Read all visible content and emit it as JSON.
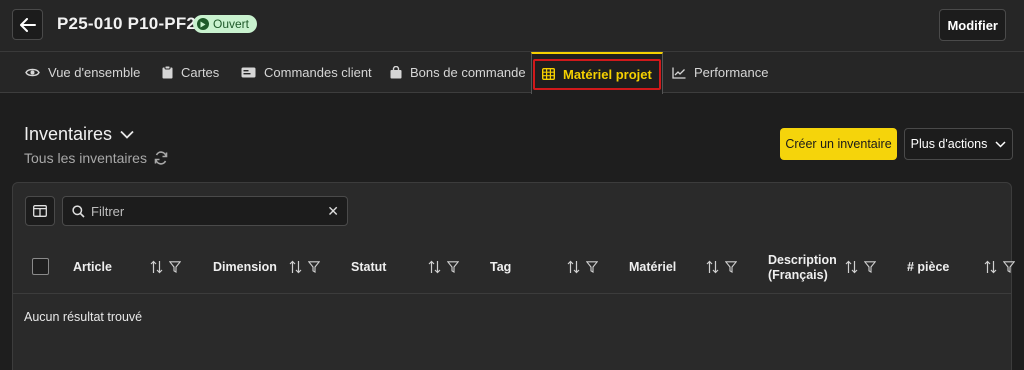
{
  "header": {
    "title": "P25-010 P10-PF2",
    "status": "Ouvert",
    "edit_label": "Modifier"
  },
  "tabs": [
    {
      "label": "Vue d'ensemble",
      "icon": "eye-icon"
    },
    {
      "label": "Cartes",
      "icon": "clipboard-icon"
    },
    {
      "label": "Commandes client",
      "icon": "id-card-icon"
    },
    {
      "label": "Bons de commande",
      "icon": "shopping-bag-icon"
    },
    {
      "label": "Matériel projet",
      "icon": "grid-table-icon",
      "active": true
    },
    {
      "label": "Performance",
      "icon": "line-chart-icon"
    }
  ],
  "section": {
    "title": "Inventaires",
    "subtitle": "Tous les inventaires"
  },
  "actions": {
    "create_label": "Créer un inventaire",
    "more_label": "Plus d'actions"
  },
  "filter": {
    "placeholder": "Filtrer"
  },
  "table": {
    "columns": [
      {
        "line1": "Article",
        "line2": ""
      },
      {
        "line1": "Dimension",
        "line2": ""
      },
      {
        "line1": "Statut",
        "line2": ""
      },
      {
        "line1": "Tag",
        "line2": ""
      },
      {
        "line1": "Matériel",
        "line2": ""
      },
      {
        "line1": "Description",
        "line2": "(Français)"
      },
      {
        "line1": "# pièce",
        "line2": ""
      }
    ],
    "empty_message": "Aucun résultat trouvé"
  },
  "colors": {
    "accent": "#f5d40b",
    "status_bg": "#c9f2cf",
    "highlight_box": "#d0191b"
  }
}
